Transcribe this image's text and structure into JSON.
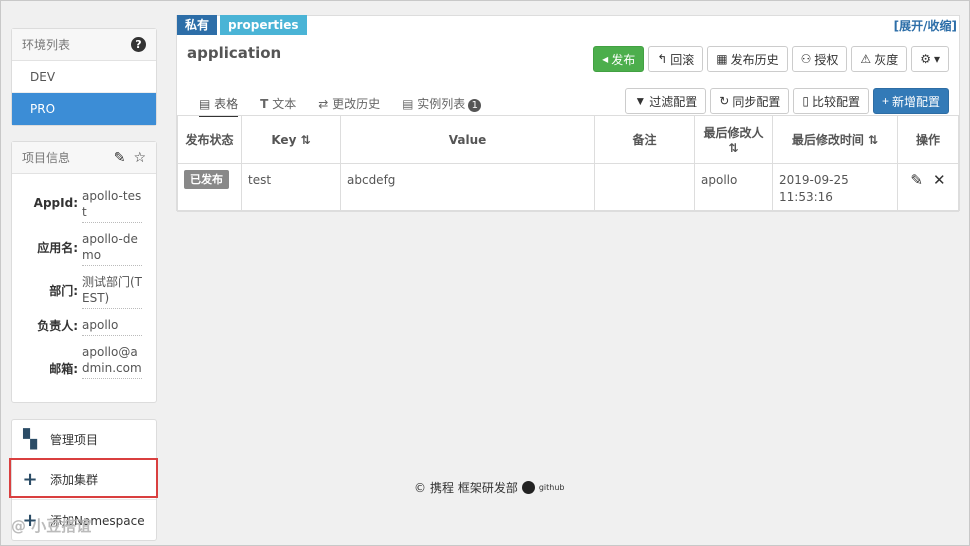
{
  "env": {
    "title": "环境列表",
    "items": [
      {
        "label": "DEV",
        "active": false
      },
      {
        "label": "PRO",
        "active": true
      }
    ]
  },
  "project": {
    "title": "项目信息",
    "fields": [
      {
        "label": "AppId:",
        "value": "apollo-test"
      },
      {
        "label": "应用名:",
        "value": "apollo-demo"
      },
      {
        "label": "部门:",
        "value": "测试部门(TEST)"
      },
      {
        "label": "负责人:",
        "value": "apollo"
      },
      {
        "label": "邮箱:",
        "value": "apollo@admin.com"
      }
    ]
  },
  "actions": {
    "manage": "管理项目",
    "add_cluster": "添加集群",
    "add_namespace": "添加Namespace"
  },
  "namespace": {
    "tag_private": "私有",
    "tag_format": "properties",
    "expand_link": "[展开/收缩]",
    "name": "application"
  },
  "buttons": {
    "publish": "发布",
    "rollback": "回滚",
    "history": "发布历史",
    "grant": "授权",
    "gray": "灰度",
    "filter": "过滤配置",
    "sync": "同步配置",
    "compare": "比较配置",
    "add": "新增配置"
  },
  "tabs": {
    "table": "表格",
    "text": "文本",
    "history": "更改历史",
    "instances": "实例列表",
    "instances_count": "1"
  },
  "table": {
    "headers": {
      "status": "发布状态",
      "key": "Key",
      "value": "Value",
      "comment": "备注",
      "modifier": "最后修改人",
      "time": "最后修改时间",
      "ops": "操作"
    },
    "rows": [
      {
        "status": "已发布",
        "key": "test",
        "value": "abcdefg",
        "comment": "",
        "modifier": "apollo",
        "time": "2019-09-25 11:53:16"
      }
    ]
  },
  "footer": {
    "text": "携程 框架研发部",
    "github": "github"
  },
  "watermark": "@ 小豆搭谊"
}
